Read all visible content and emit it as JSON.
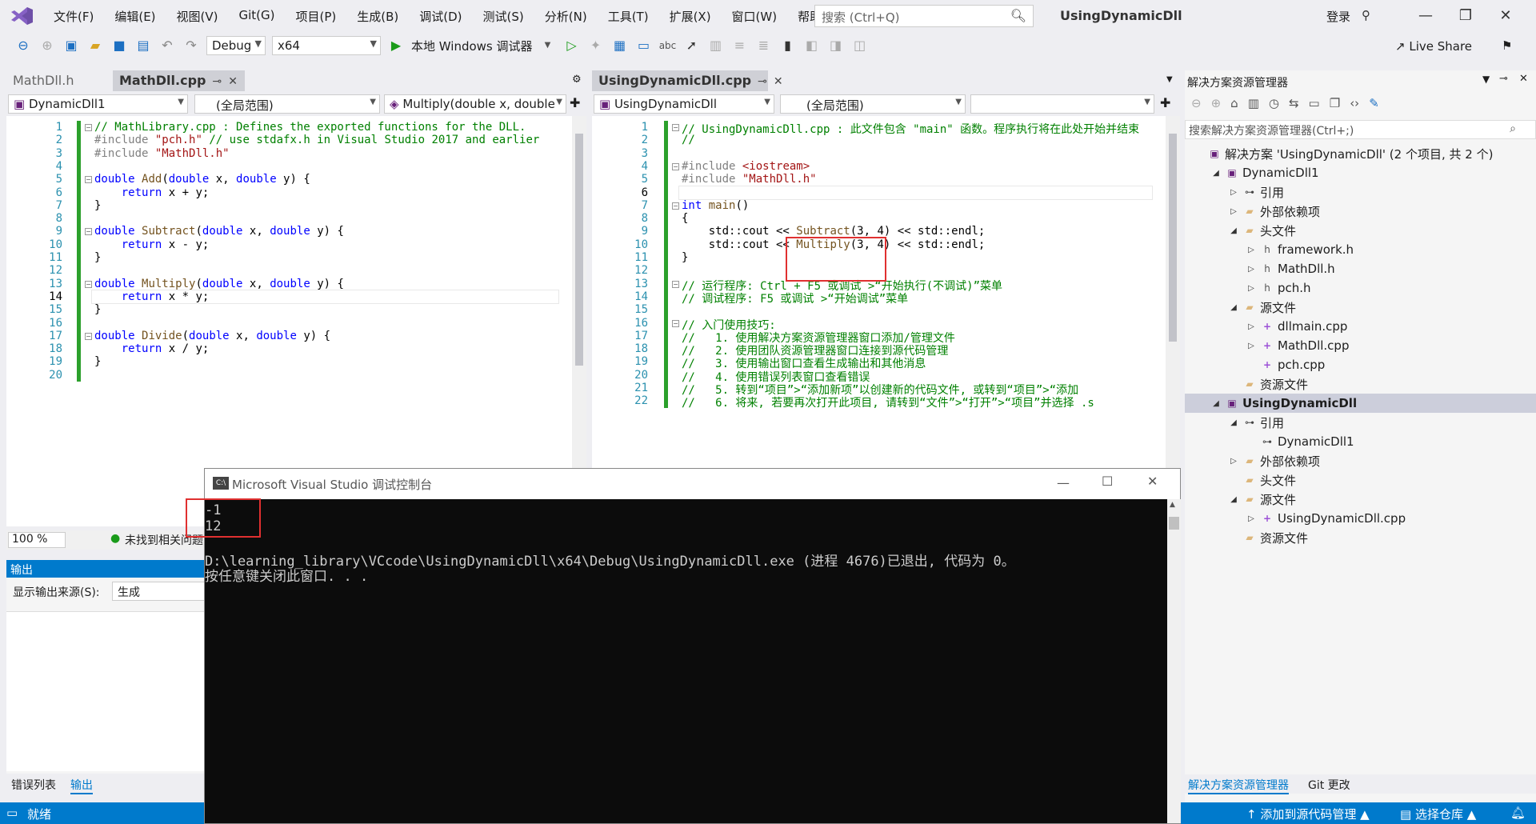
{
  "menu": {
    "items": [
      "文件(F)",
      "编辑(E)",
      "视图(V)",
      "Git(G)",
      "项目(P)",
      "生成(B)",
      "调试(D)",
      "测试(S)",
      "分析(N)",
      "工具(T)",
      "扩展(X)",
      "窗口(W)",
      "帮助(H)"
    ],
    "search_placeholder": "搜索 (Ctrl+Q)",
    "app_title": "UsingDynamicDll",
    "login": "登录"
  },
  "toolbar": {
    "config": "Debug",
    "platform": "x64",
    "run_label": "本地 Windows 调试器",
    "live_share": "Live Share"
  },
  "left_editor": {
    "tab_inactive": "MathDll.h",
    "tab_active": "MathDll.cpp",
    "project_select": "DynamicDll1",
    "scope_select": "(全局范围)",
    "member_select": "Multiply(double x, double",
    "zoom": "100 %",
    "issues": "未找到相关问题",
    "lines": [
      "// MathLibrary.cpp : Defines the exported functions for the DLL.",
      "#include \"pch.h\" // use stdafx.h in Visual Studio 2017 and earlier",
      "#include \"MathDll.h\"",
      "",
      "double Add(double x, double y) {",
      "    return x + y;",
      "}",
      "",
      "double Subtract(double x, double y) {",
      "    return x - y;",
      "}",
      "",
      "double Multiply(double x, double y) {",
      "    return x * y;",
      "}",
      "",
      "double Divide(double x, double y) {",
      "    return x / y;",
      "}",
      ""
    ],
    "current_line": 14
  },
  "right_editor": {
    "tab_active": "UsingDynamicDll.cpp",
    "project_select": "UsingDynamicDll",
    "scope_select": "(全局范围)",
    "member_select": "",
    "lines": [
      "// UsingDynamicDll.cpp : 此文件包含 \"main\" 函数。程序执行将在此处开始并结束",
      "//",
      "",
      "#include <iostream>",
      "#include \"MathDll.h\"",
      "",
      "int main()",
      "{",
      "    std::cout << Subtract(3, 4) << std::endl;",
      "    std::cout << Multiply(3, 4) << std::endl;",
      "}",
      "",
      "// 运行程序: Ctrl + F5 或调试 >“开始执行(不调试)”菜单",
      "// 调试程序: F5 或调试 >“开始调试”菜单",
      "",
      "// 入门使用技巧:",
      "//   1. 使用解决方案资源管理器窗口添加/管理文件",
      "//   2. 使用团队资源管理器窗口连接到源代码管理",
      "//   3. 使用输出窗口查看生成输出和其他消息",
      "//   4. 使用错误列表窗口查看错误",
      "//   5. 转到“项目”>“添加新项”以创建新的代码文件, 或转到“项目”>“添加",
      "//   6. 将来, 若要再次打开此项目, 请转到“文件”>“打开”>“项目”并选择 .s"
    ],
    "current_line": 6
  },
  "output_panel": {
    "title": "输出",
    "source_label": "显示输出来源(S):",
    "source_value": "生成",
    "tab_errors": "错误列表",
    "tab_output": "输出"
  },
  "console": {
    "title": "Microsoft Visual Studio 调试控制台",
    "lines": [
      "-1",
      "12",
      "",
      "D:\\learning_library\\VCcode\\UsingDynamicDll\\x64\\Debug\\UsingDynamicDll.exe (进程 4676)已退出, 代码为 0。",
      "按任意键关闭此窗口. . ."
    ]
  },
  "solution_explorer": {
    "title": "解决方案资源管理器",
    "search_placeholder": "搜索解决方案资源管理器(Ctrl+;)",
    "tree": [
      {
        "label": "解决方案 'UsingDynamicDll' (2 个项目, 共 2 个)",
        "depth": 0,
        "icon": "solution-icon",
        "twisty": ""
      },
      {
        "label": "DynamicDll1",
        "depth": 1,
        "icon": "project-icon",
        "twisty": "◢"
      },
      {
        "label": "引用",
        "depth": 2,
        "icon": "reference-icon",
        "twisty": "▷"
      },
      {
        "label": "外部依赖项",
        "depth": 2,
        "icon": "folder-icon",
        "twisty": "▷"
      },
      {
        "label": "头文件",
        "depth": 2,
        "icon": "folder-icon",
        "twisty": "◢"
      },
      {
        "label": "framework.h",
        "depth": 3,
        "icon": "header-file-icon",
        "twisty": "▷"
      },
      {
        "label": "MathDll.h",
        "depth": 3,
        "icon": "header-file-icon",
        "twisty": "▷"
      },
      {
        "label": "pch.h",
        "depth": 3,
        "icon": "header-file-icon",
        "twisty": "▷"
      },
      {
        "label": "源文件",
        "depth": 2,
        "icon": "folder-icon",
        "twisty": "◢"
      },
      {
        "label": "dllmain.cpp",
        "depth": 3,
        "icon": "cpp-file-icon",
        "twisty": "▷"
      },
      {
        "label": "MathDll.cpp",
        "depth": 3,
        "icon": "cpp-file-icon",
        "twisty": "▷"
      },
      {
        "label": "pch.cpp",
        "depth": 3,
        "icon": "cpp-file-icon",
        "twisty": ""
      },
      {
        "label": "资源文件",
        "depth": 2,
        "icon": "folder-icon",
        "twisty": ""
      },
      {
        "label": "UsingDynamicDll",
        "depth": 1,
        "icon": "project-icon",
        "twisty": "◢",
        "selected": true
      },
      {
        "label": "引用",
        "depth": 2,
        "icon": "reference-icon",
        "twisty": "◢"
      },
      {
        "label": "DynamicDll1",
        "depth": 3,
        "icon": "reference-icon",
        "twisty": ""
      },
      {
        "label": "外部依赖项",
        "depth": 2,
        "icon": "folder-icon",
        "twisty": "▷"
      },
      {
        "label": "头文件",
        "depth": 2,
        "icon": "folder-icon",
        "twisty": ""
      },
      {
        "label": "源文件",
        "depth": 2,
        "icon": "folder-icon",
        "twisty": "◢"
      },
      {
        "label": "UsingDynamicDll.cpp",
        "depth": 3,
        "icon": "cpp-file-icon",
        "twisty": "▷"
      },
      {
        "label": "资源文件",
        "depth": 2,
        "icon": "folder-icon",
        "twisty": ""
      }
    ],
    "bottom_tab_active": "解决方案资源管理器",
    "bottom_tab_other": "Git 更改"
  },
  "status": {
    "ready": "就绪",
    "add_source_control": "添加到源代码管理",
    "select_repo": "选择仓库"
  },
  "colors": {
    "accent": "#007acc",
    "highlight_box": "#e03030",
    "console_bg": "#0c0c0c"
  }
}
